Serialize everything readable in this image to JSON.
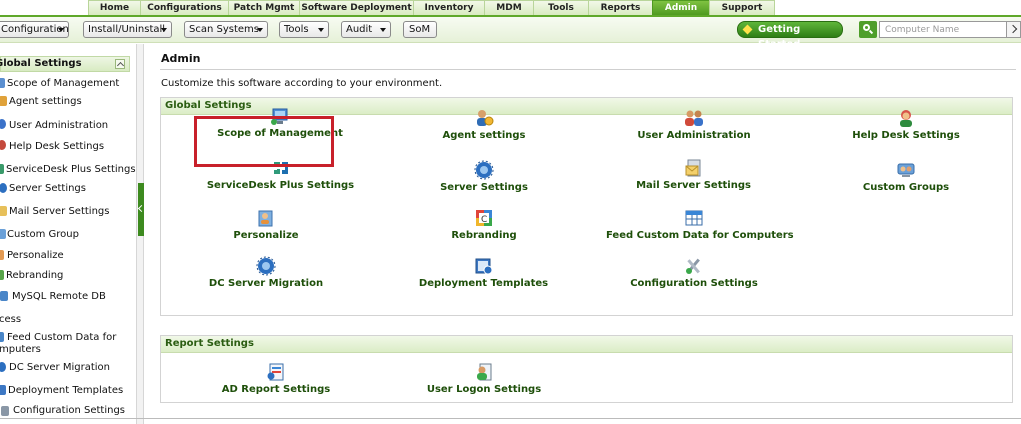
{
  "top_nav": {
    "tabs": [
      "Home",
      "Configurations",
      "Patch Mgmt",
      "Software Deployment",
      "Inventory",
      "MDM",
      "Tools",
      "Reports",
      "Admin",
      "Support"
    ],
    "active": "Admin"
  },
  "toolbar": {
    "menus": [
      "Configurations",
      "Install/Uninstall",
      "Scan Systems",
      "Tools",
      "Audit",
      "SoM"
    ],
    "getting_started": "Getting Started",
    "search_placeholder": "Computer Name"
  },
  "sidebar": {
    "header": "Global Settings",
    "items": [
      "Scope of Management",
      "Agent settings",
      "User Administration",
      "Help Desk Settings",
      "ServiceDesk Plus Settings",
      "Server Settings",
      "Mail Server Settings",
      "Custom Group",
      "Personalize",
      "Rebranding",
      "MySQL Remote DB",
      "cess",
      "Feed Custom Data for",
      "mputers",
      "DC Server Migration",
      "Deployment Templates",
      "Configuration Settings"
    ]
  },
  "main": {
    "title": "Admin",
    "subtitle": "Customize this software according to your environment.",
    "global_settings": {
      "header": "Global Settings",
      "items": [
        {
          "label": "Scope of Management",
          "icon": "scope-management-icon"
        },
        {
          "label": "Agent settings",
          "icon": "agent-settings-icon"
        },
        {
          "label": "User Administration",
          "icon": "user-administration-icon"
        },
        {
          "label": "Help Desk Settings",
          "icon": "helpdesk-icon"
        },
        {
          "label": "ServiceDesk Plus Settings",
          "icon": "servicedesk-plus-icon"
        },
        {
          "label": "Server Settings",
          "icon": "server-gear-icon"
        },
        {
          "label": "Mail Server Settings",
          "icon": "mail-server-icon"
        },
        {
          "label": "Custom Groups",
          "icon": "custom-groups-icon"
        },
        {
          "label": "Personalize",
          "icon": "personalize-icon"
        },
        {
          "label": "Rebranding",
          "icon": "rebranding-icon"
        },
        {
          "label": "Feed Custom Data for Computers",
          "icon": "feed-data-icon"
        },
        {
          "label": "DC Server Migration",
          "icon": "server-migration-icon"
        },
        {
          "label": "Deployment Templates",
          "icon": "deployment-templates-icon"
        },
        {
          "label": "Configuration Settings",
          "icon": "configuration-tools-icon"
        }
      ]
    },
    "report_settings": {
      "header": "Report Settings",
      "items": [
        {
          "label": "AD Report Settings",
          "icon": "ad-report-icon"
        },
        {
          "label": "User Logon Settings",
          "icon": "user-logon-icon"
        }
      ]
    }
  },
  "colors": {
    "accent_green": "#4f9a21",
    "label_green": "#1e4f0a",
    "highlight_red": "#c8202a"
  }
}
